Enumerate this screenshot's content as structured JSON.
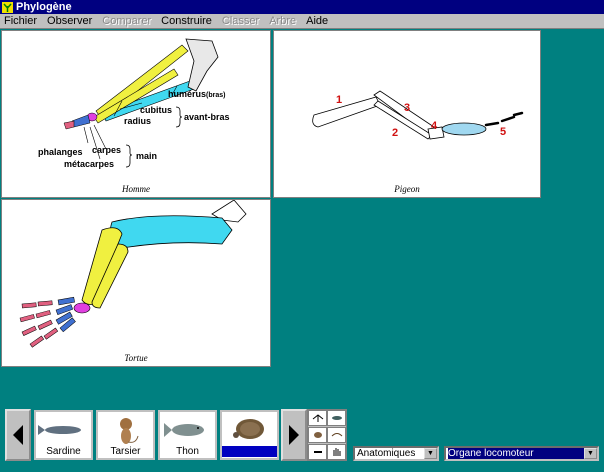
{
  "window": {
    "title": "Phylogène"
  },
  "menu": [
    {
      "label": "Fichier",
      "enabled": true
    },
    {
      "label": "Observer",
      "enabled": true
    },
    {
      "label": "Comparer",
      "enabled": false
    },
    {
      "label": "Construire",
      "enabled": true
    },
    {
      "label": "Classer",
      "enabled": false
    },
    {
      "label": "Arbre",
      "enabled": false
    },
    {
      "label": "Aide",
      "enabled": true
    }
  ],
  "panels": {
    "homme": {
      "caption": "Homme",
      "labels": {
        "humerus": "humérus",
        "humerus_note": "(bras)",
        "cubitus": "cubitus",
        "radius": "radius",
        "avant_bras": "avant-bras",
        "phalanges": "phalanges",
        "carpes": "carpes",
        "metacarpes": "métacarpes",
        "main": "main"
      }
    },
    "pigeon": {
      "caption": "Pigeon",
      "numbers": [
        "1",
        "2",
        "3",
        "4",
        "5"
      ]
    },
    "tortue": {
      "caption": "Tortue"
    }
  },
  "colors": {
    "humerus": "#40d8f0",
    "forearm": "#f0f040",
    "carpal": "#e040e0",
    "phalanx": "#e06080",
    "selection": "#0000c0"
  },
  "species": [
    {
      "name": "Sardine",
      "icon": "fish-icon",
      "selected": false
    },
    {
      "name": "Tarsier",
      "icon": "primate-icon",
      "selected": false
    },
    {
      "name": "Thon",
      "icon": "fish-icon",
      "selected": false
    },
    {
      "name": "Tortue",
      "icon": "turtle-icon",
      "selected": true
    }
  ],
  "dropdowns": {
    "category": "Anatomiques",
    "feature": "Organe locomoteur"
  }
}
